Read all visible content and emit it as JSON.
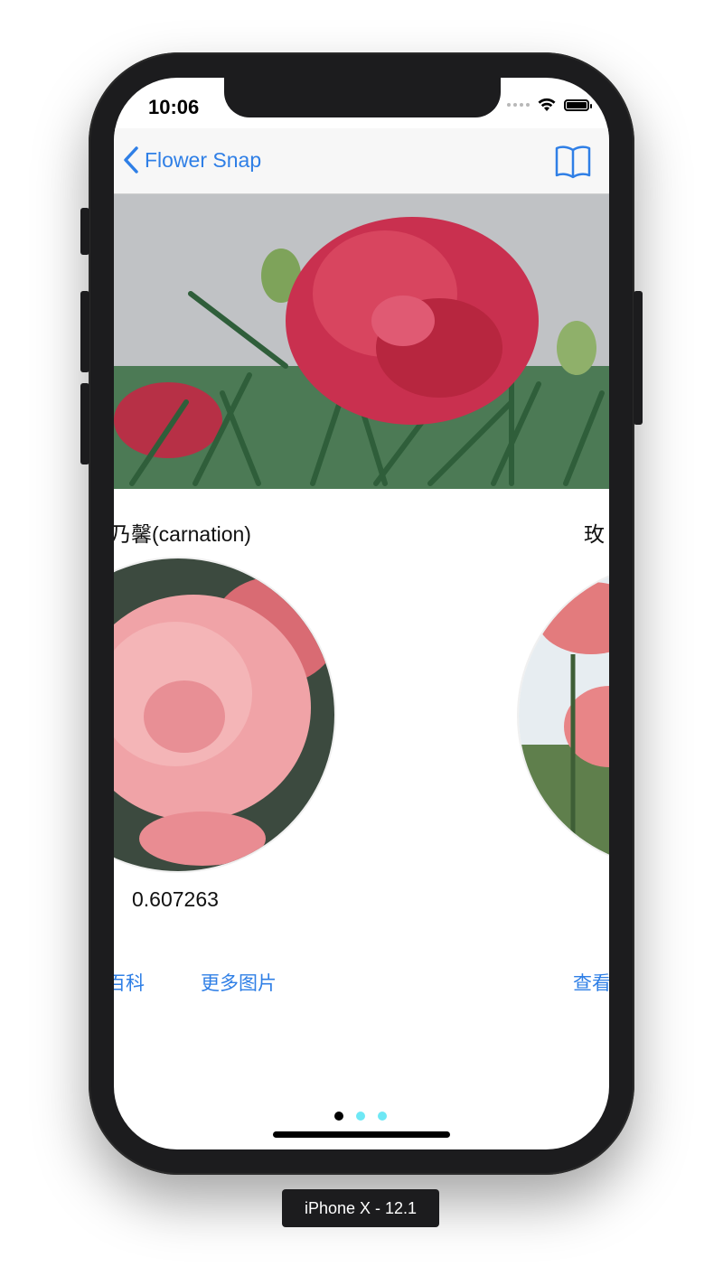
{
  "status_bar": {
    "time": "10:06"
  },
  "nav": {
    "back_label": "Flower Snap",
    "book_icon": "book-icon"
  },
  "results": [
    {
      "name": "乃馨(carnation)",
      "score": "0.607263",
      "links": [
        "百科",
        "更多图片"
      ]
    },
    {
      "name": "玫",
      "links": [
        "查看"
      ]
    }
  ],
  "pager": {
    "current": 1,
    "total": 3,
    "active_color": "#000000",
    "inactive_color": "#6ee8f5"
  },
  "device_label": "iPhone X - 12.1",
  "colors": {
    "accent": "#2f7fe6"
  }
}
